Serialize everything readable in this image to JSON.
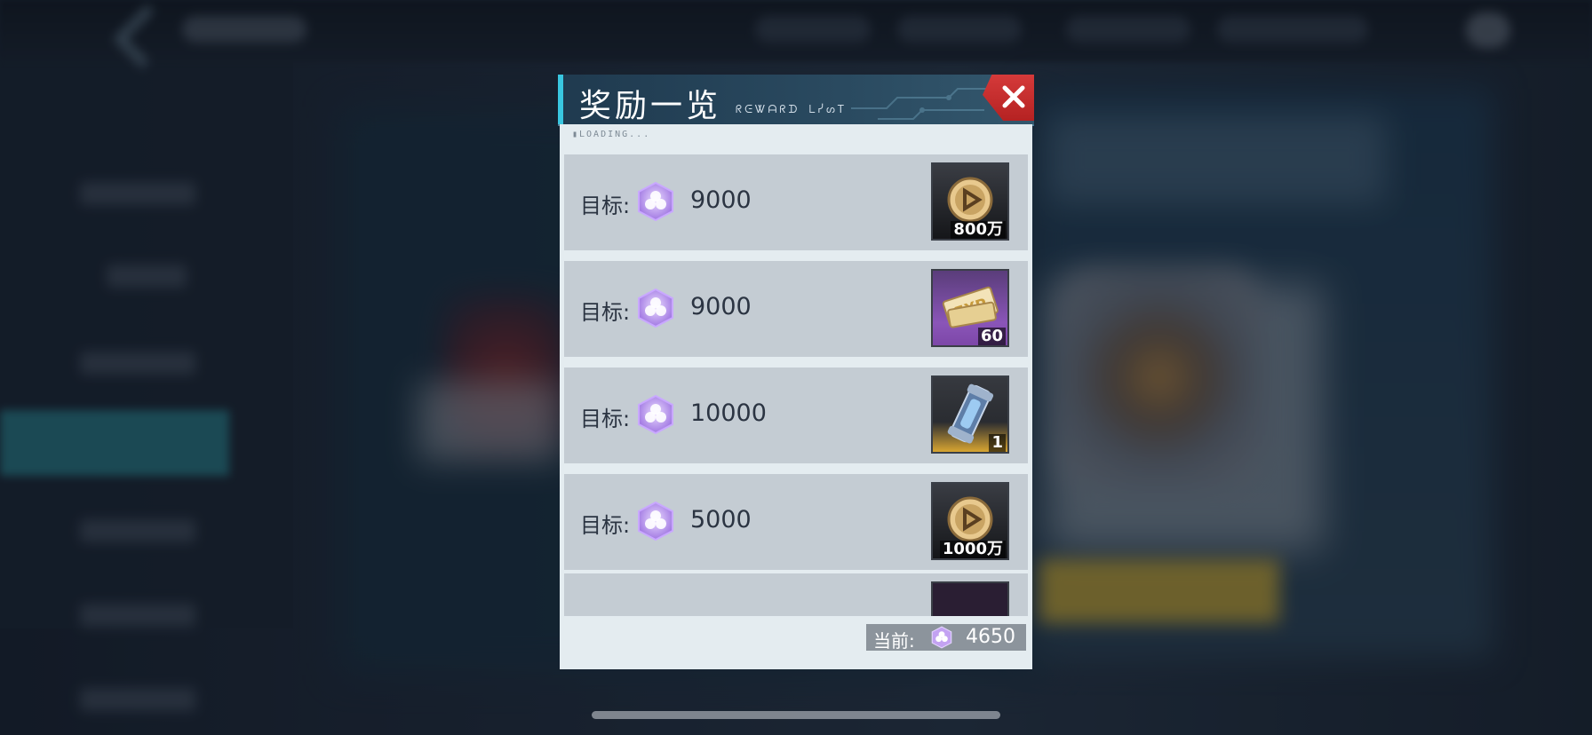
{
  "dialog": {
    "title": "奖励一览",
    "header_glyphs": "ᖇᕮᏔᗩᖇᗪ ᒪᓰᔕᎢ",
    "loading_text": "▮LOADING..."
  },
  "rows": [
    {
      "label": "目标:",
      "target": "9000",
      "reward": {
        "icon": "gold-coin-icon",
        "qty": "800万",
        "rarity": "dark"
      }
    },
    {
      "label": "目标:",
      "target": "9000",
      "reward": {
        "icon": "exp-ticket-icon",
        "qty": "60",
        "rarity": "purple"
      }
    },
    {
      "label": "目标:",
      "target": "10000",
      "reward": {
        "icon": "energy-canister-icon",
        "qty": "1",
        "rarity": "gold"
      }
    },
    {
      "label": "目标:",
      "target": "5000",
      "reward": {
        "icon": "gold-coin-icon",
        "qty": "1000万",
        "rarity": "dark"
      }
    }
  ],
  "current": {
    "label": "当前:",
    "value": "4650"
  },
  "colors": {
    "accent": "#39c6e0",
    "close": "#d53a3a",
    "gem": "#b48be8",
    "row_bg": "#c4ccd3"
  }
}
